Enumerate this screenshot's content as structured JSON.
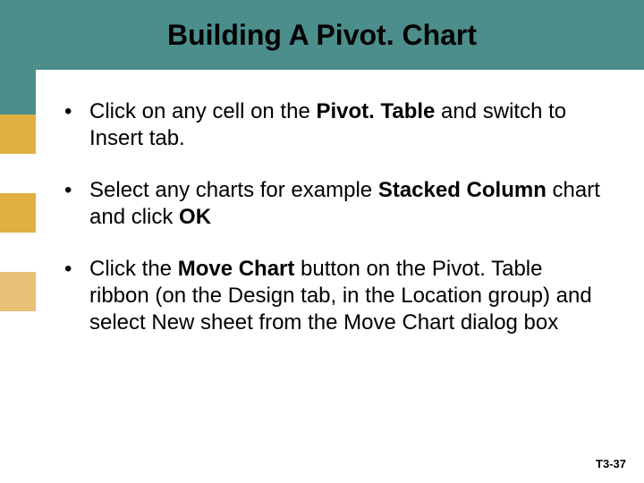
{
  "header": {
    "title": "Building A Pivot. Chart"
  },
  "bullets": [
    {
      "pre": "Click on any cell on the ",
      "bold1": "Pivot. Table",
      "post": " and switch to Insert tab."
    },
    {
      "pre": "Select  any charts for example ",
      "bold1": "Stacked Column",
      "mid": " chart and click ",
      "bold2": "OK",
      "post": ""
    },
    {
      "pre": "Click the ",
      "bold1": "Move Chart",
      "post": " button on the Pivot. Table ribbon (on the Design tab, in the Location group) and select New sheet from the Move Chart dialog box"
    }
  ],
  "footer": {
    "page": "T3-37"
  }
}
